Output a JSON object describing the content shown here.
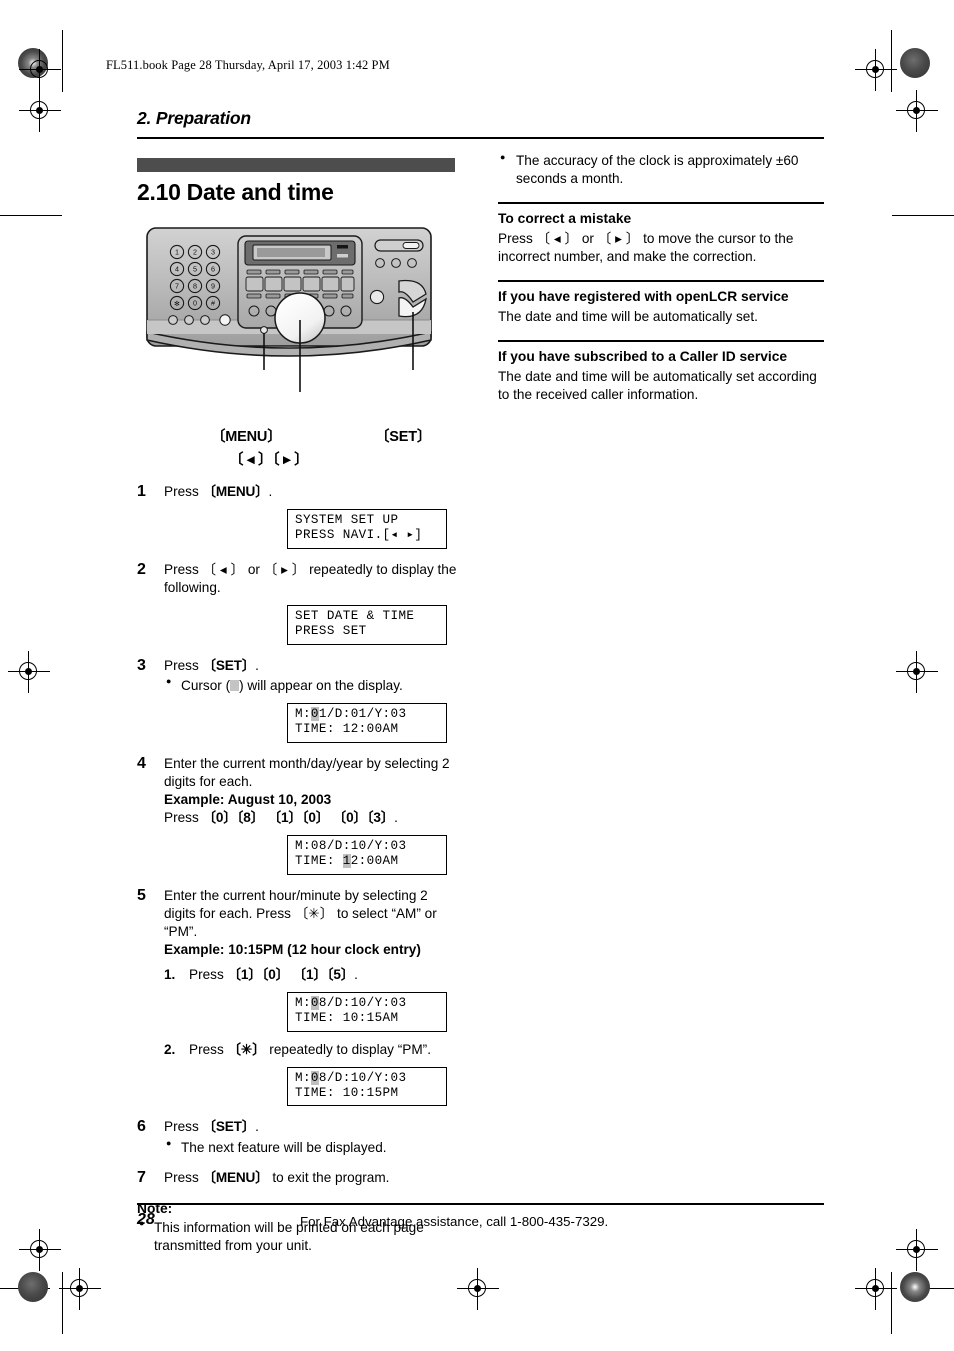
{
  "header": {
    "file_line": "FL511.book  Page 28  Thursday, April 17, 2003  1:42 PM",
    "chapter": "2. Preparation"
  },
  "section": {
    "title": "2.10 Date and time"
  },
  "illustration": {
    "callouts": {
      "menu": "〔MENU〕",
      "set": "〔SET〕",
      "navigator": "〔 ◂ 〕〔 ▸ 〕"
    },
    "keypad_labels": [
      "1",
      "2",
      "3",
      "4",
      "5",
      "6",
      "7",
      "8",
      "9",
      "✳",
      "0",
      "#"
    ]
  },
  "steps": [
    {
      "num": "1",
      "text_before": "Press ",
      "key": "〔MENU〕",
      "text_after": ".",
      "lcd": {
        "line1": "SYSTEM SET UP",
        "line2": "PRESS NAVI.[◂ ▸]"
      }
    },
    {
      "num": "2",
      "text": "Press 〔 ◂ 〕 or 〔 ▸ 〕 repeatedly to display the following.",
      "lcd": {
        "line1": "SET DATE & TIME",
        "line2": "PRESS SET"
      }
    },
    {
      "num": "3",
      "text_before": "Press ",
      "key": "〔SET〕",
      "text_after": ".",
      "bullet_before": "Cursor (",
      "bullet_after": ") will appear on the display.",
      "lcd": {
        "pre": "M:",
        "cursor": "0",
        "post1": "1/D:01/Y:03",
        "line2": "TIME: 12:00AM"
      }
    },
    {
      "num": "4",
      "text": "Enter the current month/day/year by selecting 2 digits for each.",
      "example": "Example: August 10, 2003",
      "press_label": "Press ",
      "press_keys": "〔0〕〔8〕 〔1〕〔0〕 〔0〕〔3〕",
      "press_end": ".",
      "lcd": {
        "line1": "M:08/D:10/Y:03",
        "pre2": "TIME: ",
        "cursor": "1",
        "post2": "2:00AM"
      }
    },
    {
      "num": "5",
      "text": "Enter the current hour/minute by selecting 2 digits for each. Press 〔✳〕 to select “AM” or “PM”.",
      "example": "Example: 10:15PM (12 hour clock entry)",
      "substeps": [
        {
          "num": "1.",
          "text_before": "Press ",
          "keys": "〔1〕〔0〕 〔1〕〔5〕",
          "text_after": ".",
          "lcd": {
            "pre": "M:",
            "cursor": "0",
            "post1": "8/D:10/Y:03",
            "line2": "TIME: 10:15AM"
          }
        },
        {
          "num": "2.",
          "text_before": "Press ",
          "keys": "〔✳〕",
          "text_after": " repeatedly to display “PM”.",
          "lcd": {
            "pre": "M:",
            "cursor": "0",
            "post1": "8/D:10/Y:03",
            "line2": "TIME: 10:15PM"
          }
        }
      ]
    },
    {
      "num": "6",
      "text_before": "Press ",
      "key": "〔SET〕",
      "text_after": ".",
      "bullet": "The next feature will be displayed."
    },
    {
      "num": "7",
      "text_before": "Press ",
      "key": "〔MENU〕",
      "text_after": " to exit the program."
    }
  ],
  "note": {
    "heading": "Note:",
    "bullet": "This information will be printed on each page transmitted from your unit."
  },
  "right_column": {
    "accuracy_bullet": "The accuracy of the clock is approximately ±60 seconds a month.",
    "blocks": [
      {
        "heading": "To correct a mistake",
        "body": "Press 〔 ◂ 〕 or 〔 ▸ 〕 to move the cursor to the incorrect number, and make the correction."
      },
      {
        "heading": "If you have registered with openLCR service",
        "body": "The date and time will be automatically set."
      },
      {
        "heading": "If you have subscribed to a Caller ID service",
        "body": "The date and time will be automatically set according to the received caller information."
      }
    ]
  },
  "footer": {
    "page_number": "28",
    "text": "For Fax Advantage assistance, call 1-800-435-7329."
  },
  "colors": {
    "section_bar": "#4d4d4d",
    "cursor_highlight": "#bfbfbf",
    "machine_body": "#b8b8b8"
  }
}
